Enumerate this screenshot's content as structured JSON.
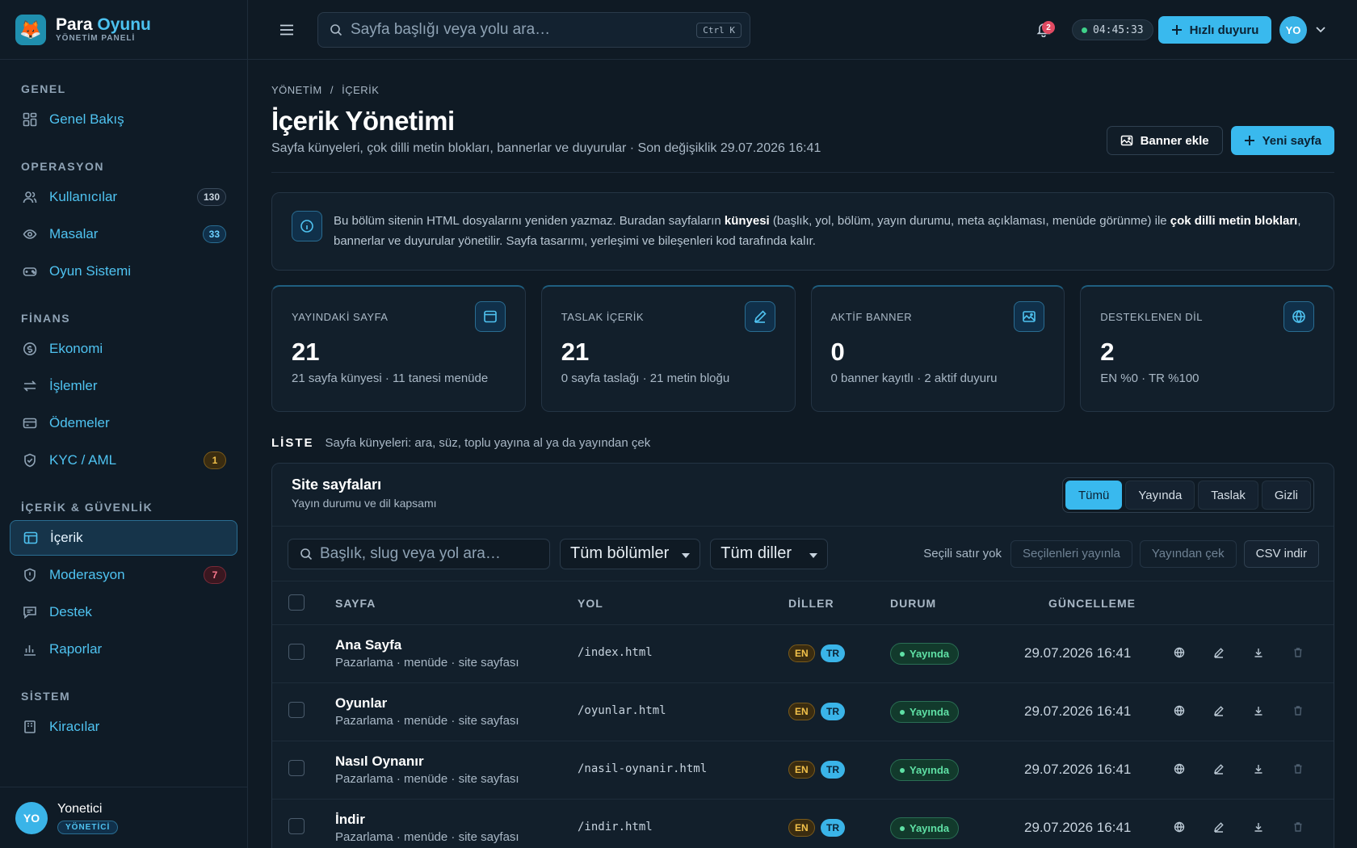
{
  "brand": {
    "name_part1": "Para",
    "name_part2": "Oyunu",
    "subtitle": "YÖNETİM PANELİ",
    "logo_icon": "fox-icon"
  },
  "sidebar": {
    "sections": [
      {
        "title": "GENEL",
        "items": [
          {
            "label": "Genel Bakış",
            "icon": "dashboard-icon"
          }
        ]
      },
      {
        "title": "OPERASYON",
        "items": [
          {
            "label": "Kullanıcılar",
            "icon": "users-icon",
            "badge": "130"
          },
          {
            "label": "Masalar",
            "icon": "eye-icon",
            "badge": "33"
          },
          {
            "label": "Oyun Sistemi",
            "icon": "gamepad-icon"
          }
        ]
      },
      {
        "title": "FİNANS",
        "items": [
          {
            "label": "Ekonomi",
            "icon": "coin-icon"
          },
          {
            "label": "İşlemler",
            "icon": "transfer-icon"
          },
          {
            "label": "Ödemeler",
            "icon": "card-icon"
          },
          {
            "label": "KYC / AML",
            "icon": "shield-check-icon",
            "badge": "1"
          }
        ]
      },
      {
        "title": "İÇERİK & GÜVENLİK",
        "items": [
          {
            "label": "İçerik",
            "icon": "layout-icon",
            "active": true
          },
          {
            "label": "Moderasyon",
            "icon": "shield-alert-icon",
            "badge": "7"
          },
          {
            "label": "Destek",
            "icon": "message-icon"
          },
          {
            "label": "Raporlar",
            "icon": "bar-chart-icon"
          }
        ]
      },
      {
        "title": "SİSTEM",
        "items": [
          {
            "label": "Kiracılar",
            "icon": "building-icon"
          }
        ]
      }
    ],
    "user": {
      "initials": "YO",
      "name": "Yonetici",
      "role": "YÖNETİCİ"
    }
  },
  "topbar": {
    "search_placeholder": "Sayfa başlığı veya yolu ara…",
    "shortcut": "Ctrl K",
    "notification_count": "2",
    "clock": "04:45:33",
    "quick_button": "Hızlı duyuru",
    "avatar_initials": "YO"
  },
  "page": {
    "breadcrumb_1": "YÖNETİM",
    "breadcrumb_sep": "/",
    "breadcrumb_2": "İÇERİK",
    "title": "İçerik Yönetimi",
    "subtitle": "Sayfa künyeleri, çok dilli metin blokları, bannerlar ve duyurular · Son değişiklik 29.07.2026 16:41",
    "banner_button": "Banner ekle",
    "new_page_button": "Yeni sayfa"
  },
  "info": {
    "t1": "Bu bölüm sitenin HTML dosyalarını yeniden yazmaz. Buradan sayfaların ",
    "b1": "künyesi",
    "t2": " (başlık, yol, bölüm, yayın durumu, meta açıklaması, menüde görünme) ile ",
    "b2": "çok dilli metin blokları",
    "t3": ", bannerlar ve duyurular yönetilir. Sayfa tasarımı, yerleşimi ve bileşenleri kod tarafında kalır."
  },
  "stats": [
    {
      "label": "YAYINDAKİ SAYFA",
      "value": "21",
      "sub": "21 sayfa künyesi · 11 tanesi menüde",
      "icon": "browser-icon"
    },
    {
      "label": "TASLAK İÇERİK",
      "value": "21",
      "sub": "0 sayfa taslağı · 21 metin bloğu",
      "icon": "pencil-icon"
    },
    {
      "label": "AKTİF BANNER",
      "value": "0",
      "sub": "0 banner kayıtlı · 2 aktif duyuru",
      "icon": "image-icon"
    },
    {
      "label": "DESTEKLENEN DİL",
      "value": "2",
      "sub": "EN %0 · TR %100",
      "icon": "globe-icon"
    }
  ],
  "list": {
    "label": "LİSTE",
    "desc": "Sayfa künyeleri: ara, süz, toplu yayına al ya da yayından çek",
    "panel_title": "Site sayfaları",
    "panel_sub": "Yayın durumu ve dil kapsamı",
    "tabs": [
      "Tümü",
      "Yayında",
      "Taslak",
      "Gizli"
    ],
    "search_placeholder": "Başlık, slug veya yol ara…",
    "section_filter": "Tüm bölümler",
    "lang_filter": "Tüm diller",
    "selection": "Seçili satır yok",
    "publish_btn": "Seçilenleri yayınla",
    "unpublish_btn": "Yayından çek",
    "csv_btn": "CSV indir",
    "columns": [
      "SAYFA",
      "YOL",
      "DİLLER",
      "DURUM",
      "GÜNCELLEME"
    ],
    "rows": [
      {
        "title": "Ana Sayfa",
        "sub": "Pazarlama · menüde · site sayfası",
        "path": "/index.html",
        "lang1": "EN",
        "lang2": "TR",
        "status": "Yayında",
        "date": "29.07.2026 16:41"
      },
      {
        "title": "Oyunlar",
        "sub": "Pazarlama · menüde · site sayfası",
        "path": "/oyunlar.html",
        "lang1": "EN",
        "lang2": "TR",
        "status": "Yayında",
        "date": "29.07.2026 16:41"
      },
      {
        "title": "Nasıl Oynanır",
        "sub": "Pazarlama · menüde · site sayfası",
        "path": "/nasil-oynanir.html",
        "lang1": "EN",
        "lang2": "TR",
        "status": "Yayında",
        "date": "29.07.2026 16:41"
      },
      {
        "title": "İndir",
        "sub": "Pazarlama · menüde · site sayfası",
        "path": "/indir.html",
        "lang1": "EN",
        "lang2": "TR",
        "status": "Yayında",
        "date": "29.07.2026 16:41"
      }
    ]
  }
}
